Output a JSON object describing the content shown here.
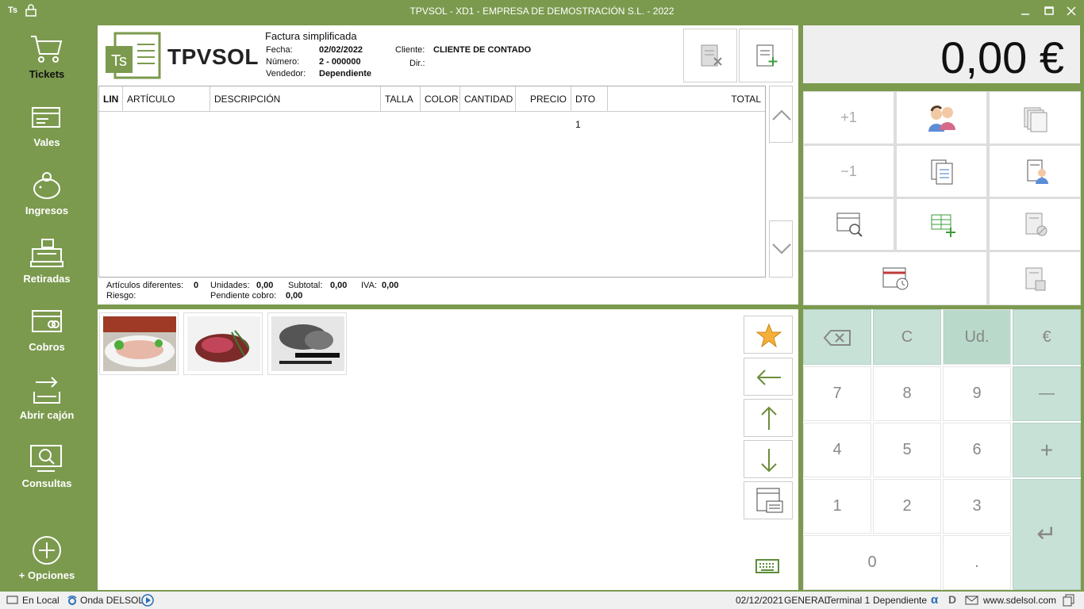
{
  "titlebar": {
    "logo": "Ts",
    "title": "TPVSOL - XD1 - EMPRESA DE DEMOSTRACIÓN S.L. - 2022"
  },
  "sidebar": {
    "items": [
      {
        "label": "Tickets",
        "icon": "cart-icon"
      },
      {
        "label": "Vales",
        "icon": "voucher-icon"
      },
      {
        "label": "Ingresos",
        "icon": "piggy-bank-icon"
      },
      {
        "label": "Retiradas",
        "icon": "cash-register-icon"
      },
      {
        "label": "Cobros",
        "icon": "card-icon"
      },
      {
        "label": "Abrir cajón",
        "icon": "open-drawer-icon"
      },
      {
        "label": "Consultas",
        "icon": "search-monitor-icon"
      },
      {
        "label": "+ Opciones",
        "icon": "plus-circle-icon"
      }
    ]
  },
  "document": {
    "brand": "TPVSOL",
    "logo_text": "Ts",
    "title": "Factura simplificada",
    "fecha_label": "Fecha:",
    "fecha": "02/02/2022",
    "numero_label": "Número:",
    "numero": "2 - 000000",
    "vendedor_label": "Vendedor:",
    "vendedor": "Dependiente",
    "cliente_label": "Cliente:",
    "cliente": "CLIENTE DE CONTADO",
    "dir_label": "Dir.:"
  },
  "grid": {
    "columns": [
      "LIN",
      "ARTÍCULO",
      "DESCRIPCIÓN",
      "TALLA",
      "COLOR",
      "CANTIDAD",
      "PRECIO",
      "DTO 1",
      "TOTAL"
    ]
  },
  "totals": {
    "articulos_label": "Artículos diferentes:",
    "articulos": "0",
    "unidades_label": "Unidades:",
    "unidades": "0,00",
    "subtotal_label": "Subtotal:",
    "subtotal": "0,00",
    "iva_label": "IVA:",
    "iva": "0,00",
    "riesgo_label": "Riesgo:",
    "pendiente_label": "Pendiente cobro:",
    "pendiente": "0,00"
  },
  "amount": "0,00 €",
  "functions": {
    "plus_one": "+1",
    "minus_one": "−1"
  },
  "keypad": {
    "backspace": "⌫",
    "clear": "C",
    "unit": "Ud.",
    "euro": "€",
    "k7": "7",
    "k8": "8",
    "k9": "9",
    "minus": "—",
    "k4": "4",
    "k5": "5",
    "k6": "6",
    "plus": "+",
    "k1": "1",
    "k2": "2",
    "k3": "3",
    "k0": "0",
    "dot": ".",
    "enter": "↵"
  },
  "status": {
    "location": "En Local",
    "radio": "Onda DELSOL",
    "date": "02/12/2021",
    "group": "GENERAL",
    "terminal": "Terminal 1",
    "user": "Dependiente",
    "web": "www.sdelsol.com"
  }
}
